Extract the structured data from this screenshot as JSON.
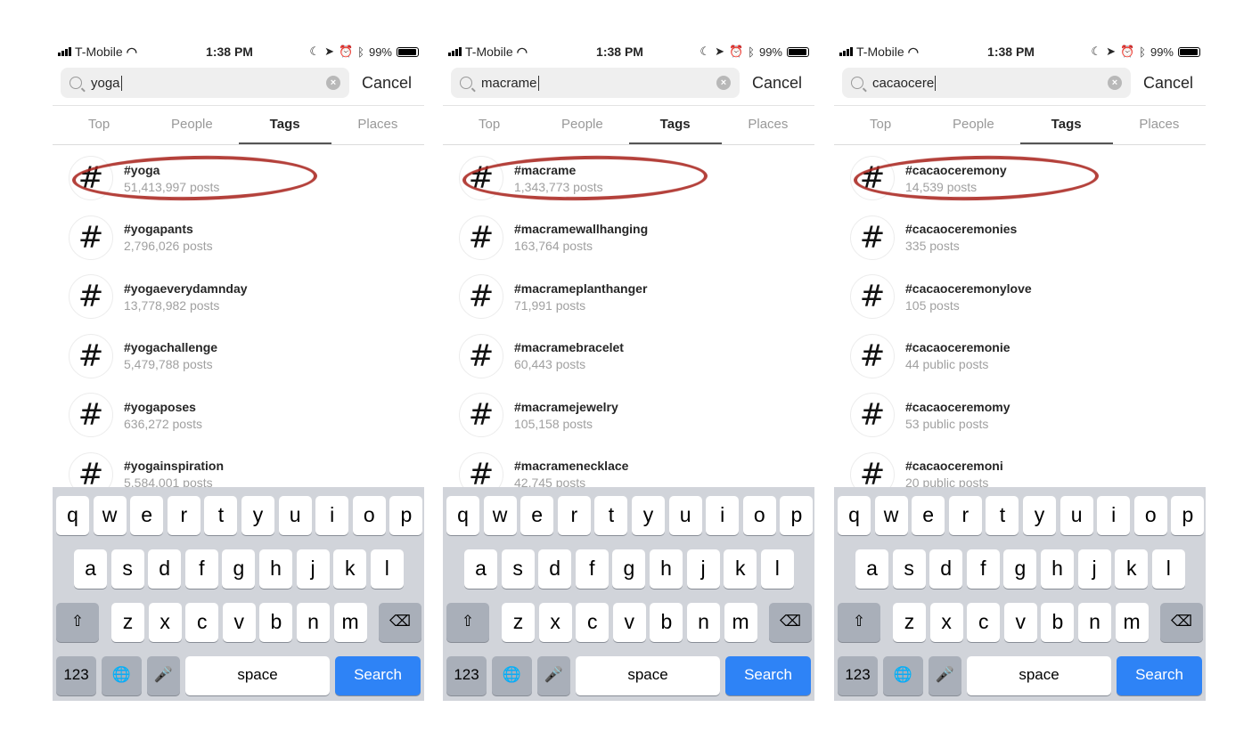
{
  "status": {
    "carrier": "T-Mobile",
    "time": "1:38 PM",
    "battery": "99%",
    "battery_level": 0.99
  },
  "tabs": [
    "Top",
    "People",
    "Tags",
    "Places"
  ],
  "active_tab": "Tags",
  "cancel_label": "Cancel",
  "highlight_color": "#a8201a",
  "keyboard": {
    "row1": [
      "q",
      "w",
      "e",
      "r",
      "t",
      "y",
      "u",
      "i",
      "o",
      "p"
    ],
    "row2": [
      "a",
      "s",
      "d",
      "f",
      "g",
      "h",
      "j",
      "k",
      "l"
    ],
    "row3": [
      "z",
      "x",
      "c",
      "v",
      "b",
      "n",
      "m"
    ],
    "numbers": "123",
    "space": "space",
    "search": "Search",
    "search_color": "#2e83f6"
  },
  "panels": [
    {
      "query": "yoga",
      "results": [
        {
          "tag": "#yoga",
          "posts": "51,413,997 posts"
        },
        {
          "tag": "#yogapants",
          "posts": "2,796,026 posts"
        },
        {
          "tag": "#yogaeverydamnday",
          "posts": "13,778,982 posts"
        },
        {
          "tag": "#yogachallenge",
          "posts": "5,479,788 posts"
        },
        {
          "tag": "#yogaposes",
          "posts": "636,272 posts"
        },
        {
          "tag": "#yogainspiration",
          "posts": "5,584,001 posts"
        }
      ]
    },
    {
      "query": "macrame",
      "results": [
        {
          "tag": "#macrame",
          "posts": "1,343,773 posts"
        },
        {
          "tag": "#macramewallhanging",
          "posts": "163,764 posts"
        },
        {
          "tag": "#macrameplanthanger",
          "posts": "71,991 posts"
        },
        {
          "tag": "#macramebracelet",
          "posts": "60,443 posts"
        },
        {
          "tag": "#macramejewelry",
          "posts": "105,158 posts"
        },
        {
          "tag": "#macramenecklace",
          "posts": "42,745 posts"
        }
      ]
    },
    {
      "query": "cacaocere",
      "results": [
        {
          "tag": "#cacaoceremony",
          "posts": "14,539 posts"
        },
        {
          "tag": "#cacaoceremonies",
          "posts": "335 posts"
        },
        {
          "tag": "#cacaoceremonylove",
          "posts": "105 posts"
        },
        {
          "tag": "#cacaoceremonie",
          "posts": "44 public posts"
        },
        {
          "tag": "#cacaoceremomy",
          "posts": "53 public posts"
        },
        {
          "tag": "#cacaoceremoni",
          "posts": "20 public posts"
        }
      ]
    }
  ]
}
